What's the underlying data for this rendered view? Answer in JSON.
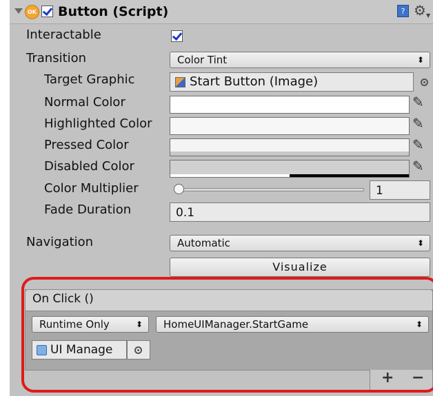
{
  "header": {
    "title": "Button (Script)",
    "badge_text": "OK",
    "enabled": true,
    "help_icon_glyph": "?",
    "gear_icon_glyph": "⚙"
  },
  "properties": {
    "interactable": {
      "label": "Interactable",
      "checked": true
    },
    "transition": {
      "label": "Transition",
      "value": "Color Tint"
    },
    "target_graphic": {
      "label": "Target Graphic",
      "value": "Start Button (Image)"
    },
    "normal_color": {
      "label": "Normal Color",
      "color": "#ffffff"
    },
    "highlighted_color": {
      "label": "Highlighted Color",
      "color": "#f5f5f5"
    },
    "pressed_color": {
      "label": "Pressed Color",
      "color": "#c8c8c8"
    },
    "disabled_color": {
      "label": "Disabled Color",
      "color": "#c8c8c8",
      "alpha_fraction": 0.5
    },
    "color_multiplier": {
      "label": "Color Multiplier",
      "value": "1",
      "slider_fraction": 0.0
    },
    "fade_duration": {
      "label": "Fade Duration",
      "value": "0.1"
    },
    "navigation": {
      "label": "Navigation",
      "value": "Automatic"
    },
    "visualize_button": "Visualize"
  },
  "on_click": {
    "title": "On Click ()",
    "runtime_mode": "Runtime Only",
    "function": "HomeUIManager.StartGame",
    "object": "UI Manage",
    "add_label": "+",
    "remove_label": "−"
  },
  "colors": {
    "highlight_border": "#e11a1a",
    "checkmark": "#1a3cc7"
  }
}
